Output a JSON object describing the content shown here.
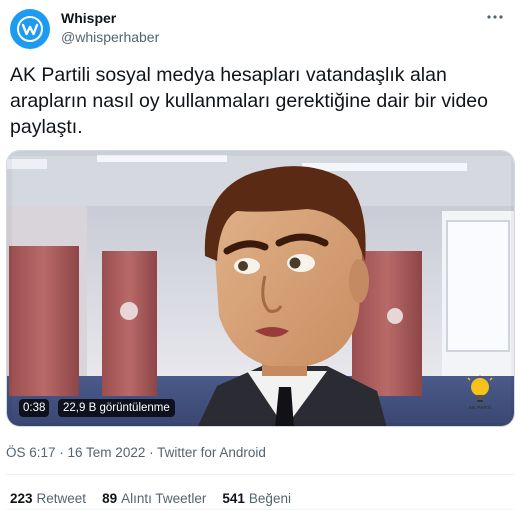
{
  "account": {
    "name": "Whisper",
    "handle": "@whisperhaber",
    "avatar_icon": "whisper-w-logo-icon",
    "avatar_color": "#1d9bf0"
  },
  "more_icon": "more-horizontal-icon",
  "tweet": {
    "text": "AK Partili sosyal medya hesapları vatandaşlık alan arapların nasıl oy kullanmaları gerektiğine dair bir video paylaştı."
  },
  "video": {
    "duration": "0:38",
    "views": "22,9 B görüntülenme",
    "watermark": "AK PARTİ",
    "watermark_icon": "light-bulb-icon"
  },
  "meta": {
    "time": "ÖS 6:17",
    "date": "16 Tem 2022",
    "source": "Twitter for Android",
    "separator": " · "
  },
  "stats": {
    "retweets_count": "223",
    "retweets_label": "Retweet",
    "quotes_count": "89",
    "quotes_label": "Alıntı Tweetler",
    "likes_count": "541",
    "likes_label": "Beğeni"
  },
  "colors": {
    "accent": "#1d9bf0",
    "text_primary": "#0f1419",
    "text_secondary": "#536471"
  }
}
